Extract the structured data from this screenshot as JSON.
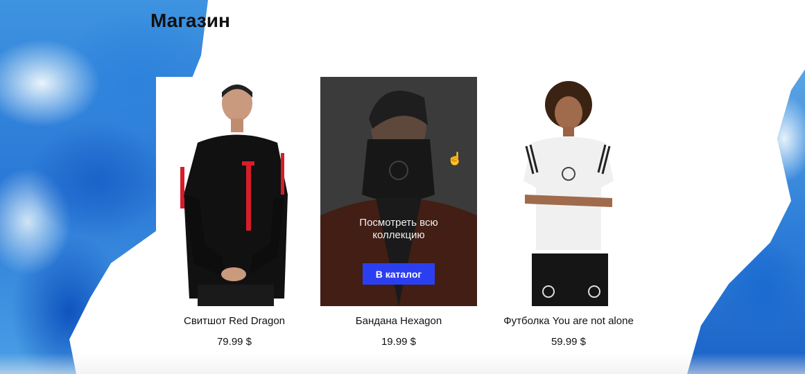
{
  "page": {
    "title": "Магазин"
  },
  "products": [
    {
      "name": "Свитшот Red Dragon",
      "price": "79.99 $",
      "image": "sweatshirt-photo"
    },
    {
      "name": "Бандана Hexagon",
      "price": "19.99 $",
      "image": "bandana-photo",
      "overlay": {
        "text": "Посмотреть всю коллекцию",
        "button_label": "В каталог"
      }
    },
    {
      "name": "Футболка You are not alone",
      "price": "59.99 $",
      "image": "tshirt-photo"
    }
  ],
  "colors": {
    "accent": "#2b3ff0",
    "paint": "#2a78d6"
  },
  "icons": {
    "cursor": "hand-pointer-icon"
  }
}
